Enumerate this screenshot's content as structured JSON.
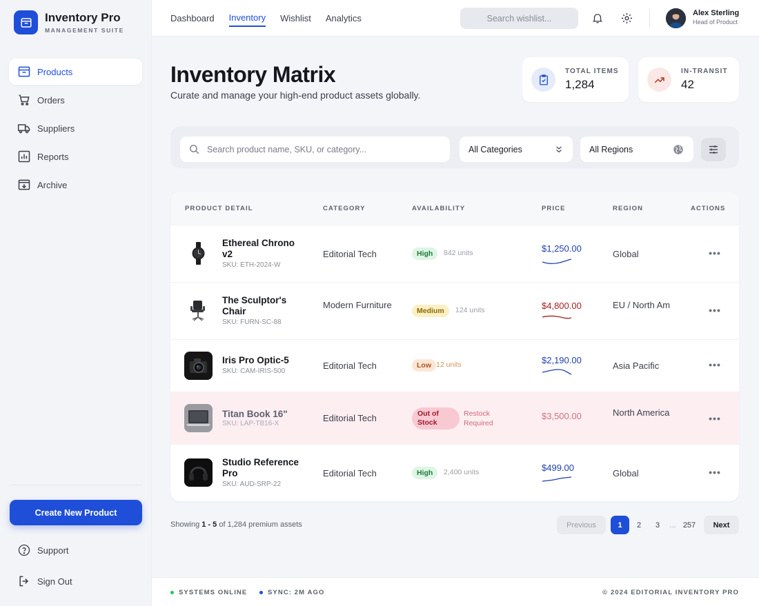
{
  "brand": {
    "title": "Inventory Pro",
    "subtitle": "MANAGEMENT SUITE"
  },
  "sidebar": {
    "items": [
      {
        "label": "Products",
        "icon": "archive-box-icon",
        "active": true
      },
      {
        "label": "Orders",
        "icon": "cart-icon"
      },
      {
        "label": "Suppliers",
        "icon": "truck-icon"
      },
      {
        "label": "Reports",
        "icon": "chart-icon"
      },
      {
        "label": "Archive",
        "icon": "archive-down-icon"
      }
    ],
    "create_label": "Create New Product",
    "support_label": "Support",
    "signout_label": "Sign Out"
  },
  "topnav": {
    "links": [
      "Dashboard",
      "Inventory",
      "Wishlist",
      "Analytics"
    ],
    "active": "Inventory",
    "search_placeholder": "Search wishlist..."
  },
  "user": {
    "name": "Alex Sterling",
    "role": "Head of Product"
  },
  "header": {
    "title": "Inventory Matrix",
    "subtitle": "Curate and manage your high-end product assets globally."
  },
  "stats": [
    {
      "label": "TOTAL ITEMS",
      "value": "1,284",
      "icon": "clipboard-check-icon"
    },
    {
      "label": "IN-TRANSIT",
      "value": "42",
      "icon": "trending-up-icon"
    }
  ],
  "filters": {
    "search_placeholder": "Search product name, SKU, or category...",
    "category": "All Categories",
    "region": "All Regions"
  },
  "table": {
    "columns": [
      "PRODUCT DETAIL",
      "CATEGORY",
      "AVAILABILITY",
      "PRICE",
      "REGION",
      "ACTIONS"
    ],
    "rows": [
      {
        "name": "Ethereal Chrono v2",
        "sku": "SKU: ETH-2024-W",
        "category": "Editorial Tech",
        "availability": "High",
        "units": "842 units",
        "price": "$1,250.00",
        "region": "Global",
        "status": "high",
        "image": "watch"
      },
      {
        "name": "The Sculptor's Chair",
        "sku": "SKU: FURN-SC-88",
        "category": "Modern Furniture",
        "availability": "Medium",
        "units": "124 units",
        "price": "$4,800.00",
        "region": "EU / North Am",
        "status": "medium",
        "image": "chair"
      },
      {
        "name": "Iris Pro Optic-5",
        "sku": "SKU: CAM-IRIS-500",
        "category": "Editorial Tech",
        "availability": "Low",
        "units": "12 units",
        "price": "$2,190.00",
        "region": "Asia Pacific",
        "status": "low",
        "image": "camera"
      },
      {
        "name": "Titan Book 16\"",
        "sku": "SKU: LAP-TB16-X",
        "category": "Editorial Tech",
        "availability": "Out of Stock",
        "units": "Restock Required",
        "price": "$3,500.00",
        "region": "North America",
        "status": "out",
        "image": "laptop"
      },
      {
        "name": "Studio Reference Pro",
        "sku": "SKU: AUD-SRP-22",
        "category": "Editorial Tech",
        "availability": "High",
        "units": "2,400 units",
        "price": "$499.00",
        "region": "Global",
        "status": "high",
        "image": "headphones"
      }
    ]
  },
  "pagination": {
    "showing_prefix": "Showing ",
    "showing_range": "1 - 5",
    "showing_mid": " of ",
    "showing_total": "1,284",
    "showing_suffix": " premium assets",
    "previous": "Previous",
    "pages": [
      "1",
      "2",
      "3",
      "...",
      "257"
    ],
    "current": "1",
    "next": "Next"
  },
  "footer": {
    "status": "SYSTEMS ONLINE",
    "sync": "SYNC: 2M AGO",
    "copyright": "© 2024 EDITORIAL INVENTORY PRO"
  },
  "colors": {
    "accent": "#1f4fd8",
    "high_bg": "#dff5e5",
    "high_fg": "#1f7a3a",
    "medium_bg": "#fbf0c4",
    "medium_fg": "#8a6a07",
    "low_bg": "#fbe6d6",
    "low_fg": "#b0541c",
    "out_bg": "#f9c9d2",
    "out_fg": "#9b1b2e",
    "price_up": "#1f3fae",
    "price_down": "#a61f1f"
  }
}
